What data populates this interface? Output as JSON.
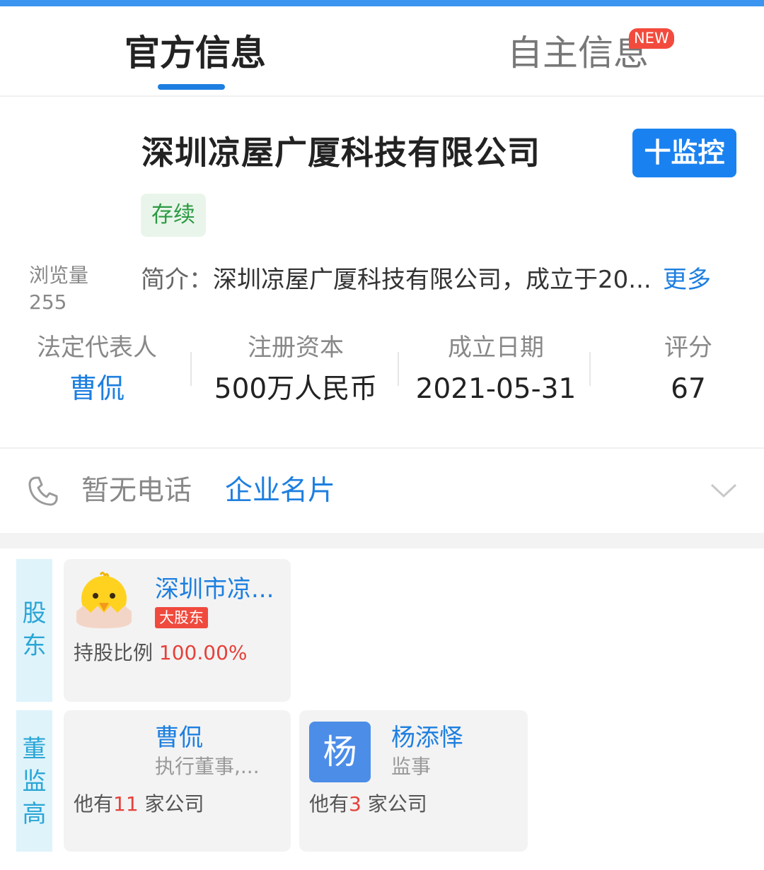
{
  "tabs": {
    "official": "官方信息",
    "self": "自主信息",
    "new_badge": "NEW"
  },
  "company": {
    "name": "深圳凉屋广厦科技有限公司",
    "monitor_button": "十监控",
    "status": "存续",
    "views_label": "浏览量",
    "views_count": "255",
    "intro_label": "简介：",
    "intro_text": "深圳凉屋广厦科技有限公司，成立于20...",
    "intro_more": "更多"
  },
  "stats": [
    {
      "label": "法定代表人",
      "value": "曹侃"
    },
    {
      "label": "注册资本",
      "value": "500万人民币"
    },
    {
      "label": "成立日期",
      "value": "2021-05-31"
    },
    {
      "label": "评分",
      "value": "67"
    }
  ],
  "contact": {
    "phone_text": "暂无电话",
    "card_link": "企业名片"
  },
  "shareholders": {
    "side_label": [
      "股",
      "东"
    ],
    "items": [
      {
        "name": "深圳市凉...",
        "badge": "大股东",
        "ratio_label": "持股比例 ",
        "ratio_value": "100.00%"
      }
    ]
  },
  "executives": {
    "side_label": [
      "董",
      "监",
      "高"
    ],
    "items": [
      {
        "name": "曹侃",
        "role": "执行董事,...",
        "count_prefix": "他有",
        "count": "11",
        "count_suffix": " 家公司"
      },
      {
        "name": "杨添怿",
        "role": "监事",
        "avatar_char": "杨",
        "count_prefix": "他有",
        "count": "3",
        "count_suffix": " 家公司"
      }
    ]
  },
  "colors": {
    "accent": "#1d7fe0",
    "status_green": "#2c9a43",
    "badge_red": "#f04a3e"
  },
  "icons": {
    "phone": "phone-icon",
    "chevron": "chevron-down-icon",
    "shareholder_avatar": "chick-avatar-icon"
  }
}
